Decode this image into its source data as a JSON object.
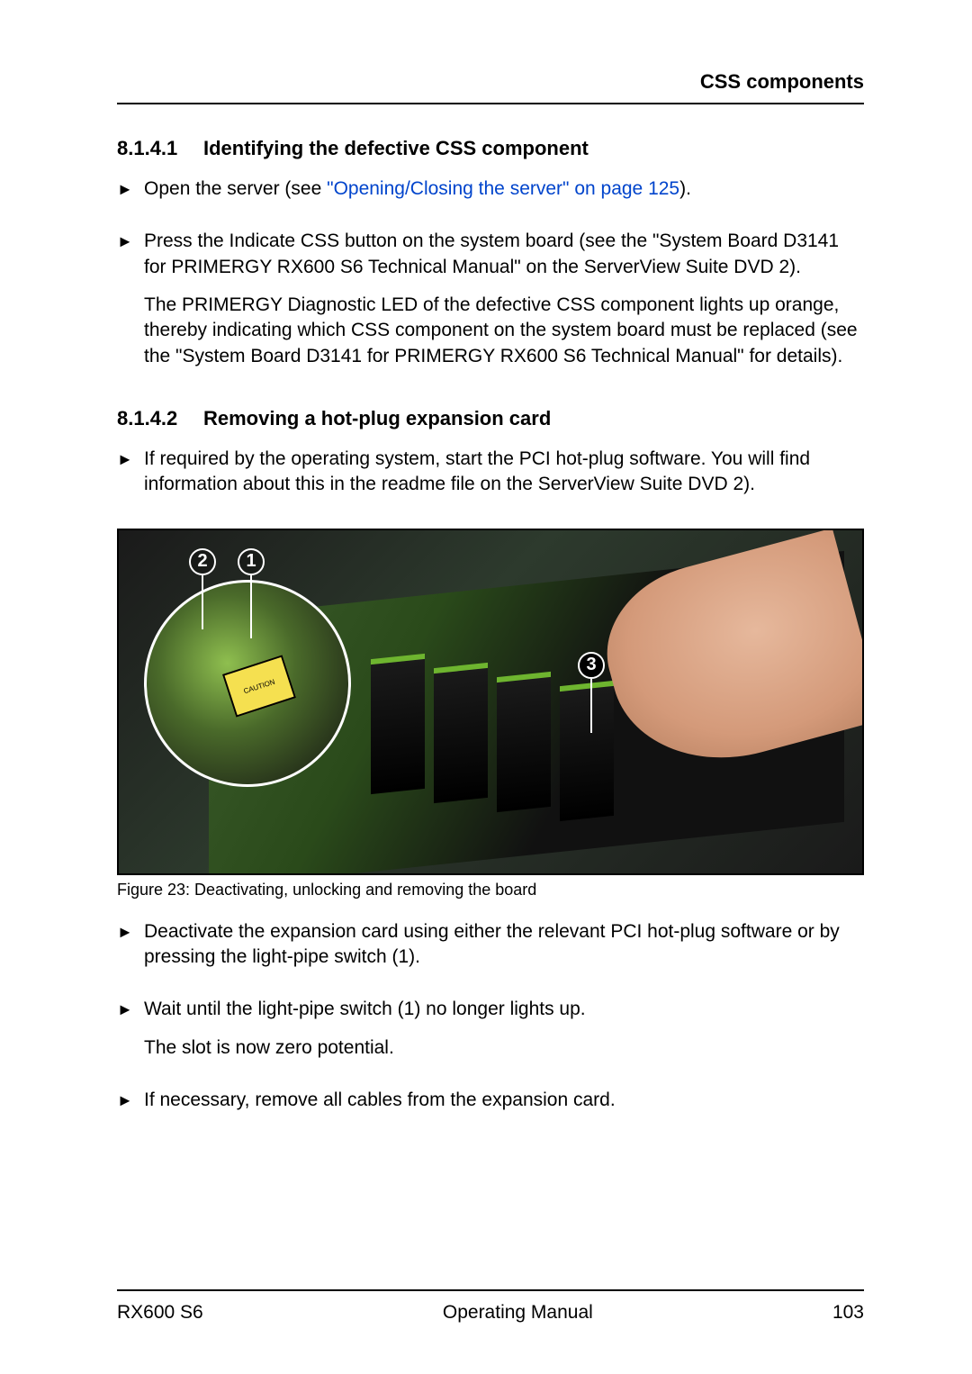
{
  "header": {
    "right_title": "CSS components"
  },
  "section1": {
    "number": "8.1.4.1",
    "title": "Identifying the defective CSS component",
    "steps": [
      {
        "pre_link": "Open the server (see ",
        "link_text": "\"Opening/Closing the server\" on page 125",
        "post_link": ")."
      },
      {
        "para1": "Press the Indicate CSS button on the system board (see the \"System Board D3141 for PRIMERGY RX600 S6 Technical Manual\" on the ServerView Suite DVD 2).",
        "para2": "The PRIMERGY Diagnostic LED of the defective CSS component lights up orange, thereby indicating which CSS component on the system board must be replaced (see the \"System Board D3141 for PRIMERGY RX600 S6 Technical Manual\" for details)."
      }
    ]
  },
  "section2": {
    "number": "8.1.4.2",
    "title": "Removing a hot-plug expansion card",
    "intro_step": "If required by the operating system, start the PCI hot-plug software. You will find information about this in the readme file on the ServerView Suite DVD 2).",
    "figure": {
      "callouts": {
        "c1": "1",
        "c2": "2",
        "c3": "3"
      },
      "caution_label": "CAUTION",
      "caption": "Figure 23: Deactivating, unlocking and removing the board"
    },
    "steps_after": [
      "Deactivate the expansion card using either the relevant PCI hot-plug software or by pressing the light-pipe switch (1).",
      "Wait until the light-pipe switch (1) no longer lights up.",
      "If necessary, remove all cables from the expansion card."
    ],
    "zero_potential": "The slot is now zero potential."
  },
  "footer": {
    "left": "RX600 S6",
    "center": "Operating Manual",
    "right": "103"
  }
}
